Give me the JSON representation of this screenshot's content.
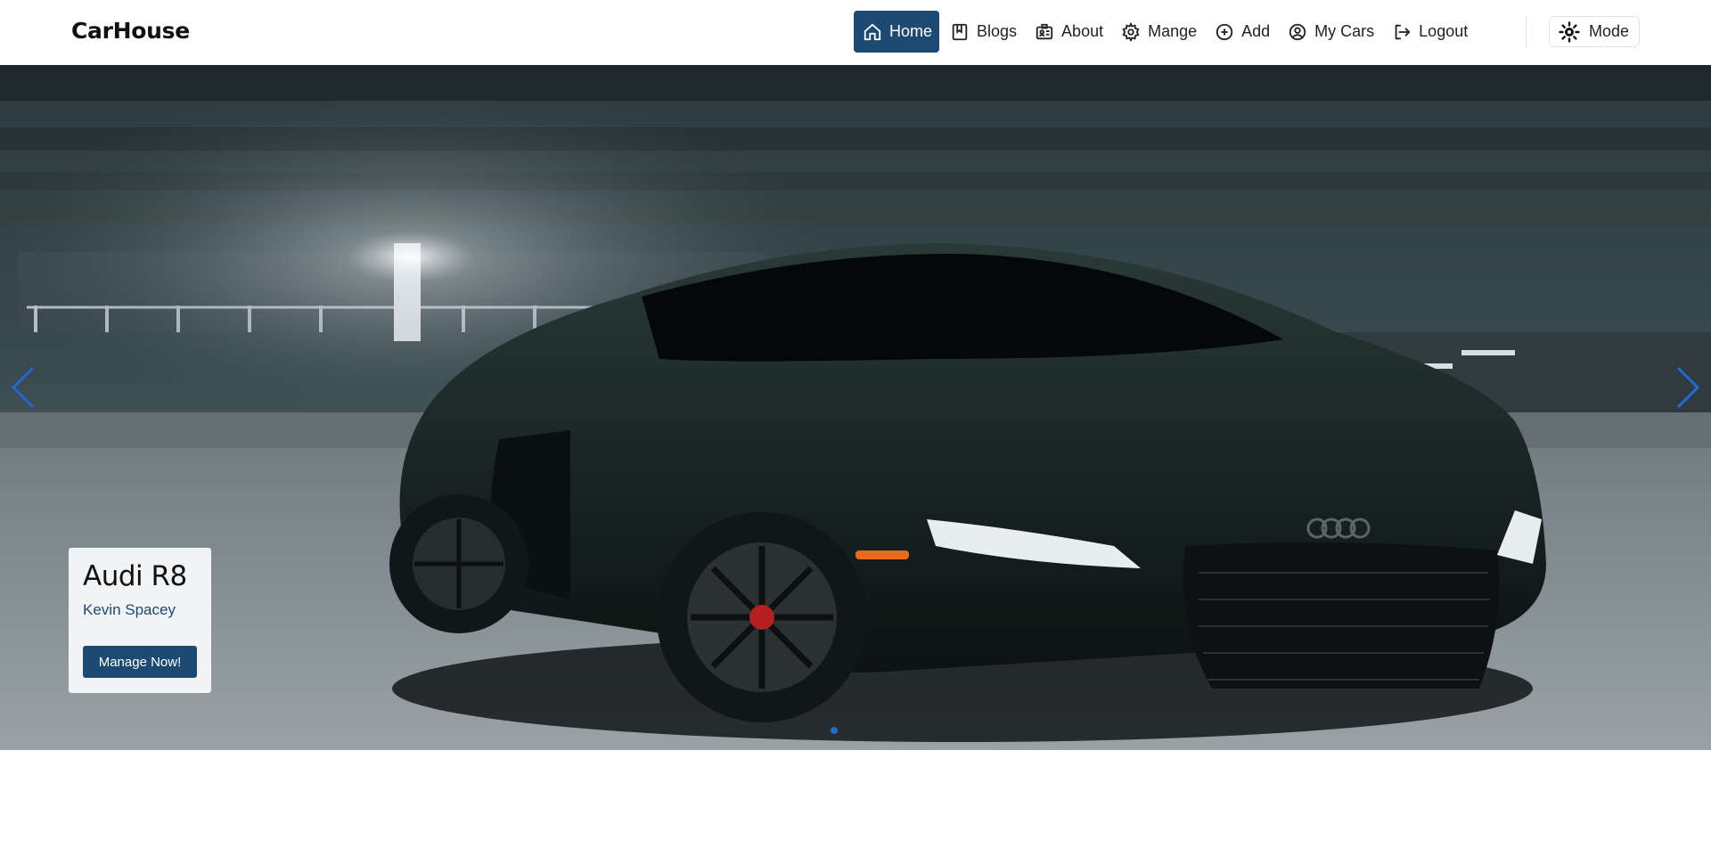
{
  "header": {
    "logo": "CarHouse",
    "nav": [
      {
        "label": "Home",
        "icon": "home-icon",
        "active": true
      },
      {
        "label": "Blogs",
        "icon": "book-icon"
      },
      {
        "label": "About",
        "icon": "id-card-icon"
      },
      {
        "label": "Mange",
        "icon": "gear-icon"
      },
      {
        "label": "Add",
        "icon": "plus-circle-icon"
      },
      {
        "label": "My Cars",
        "icon": "user-circle-icon"
      },
      {
        "label": "Logout",
        "icon": "logout-icon"
      }
    ],
    "mode_label": "Mode",
    "mode_icon": "sun-icon"
  },
  "carousel": {
    "slide": {
      "title": "Audi R8",
      "owner": "Kevin Spacey",
      "cta_label": "Manage Now!"
    },
    "prev_icon": "chevron-left-icon",
    "next_icon": "chevron-right-icon",
    "active_dot": 1,
    "dot_color": "#1e6ad6"
  },
  "colors": {
    "accent": "#1d4a73",
    "arrow": "#1e6ad6"
  }
}
